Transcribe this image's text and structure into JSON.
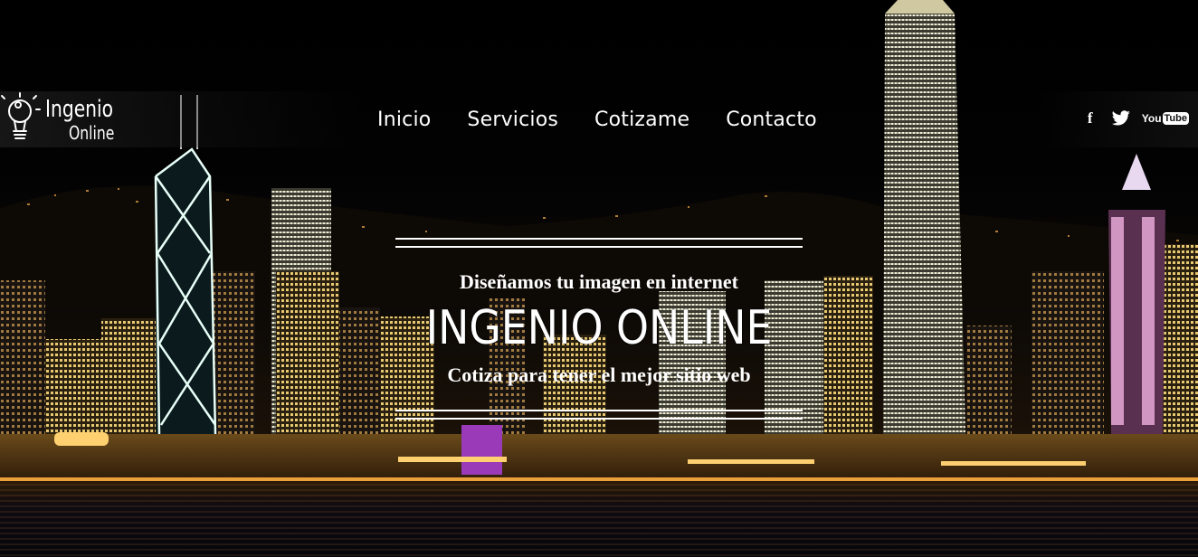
{
  "logo": {
    "line1": "Ingenio",
    "line2": "Online",
    "icon": "lightbulb-icon"
  },
  "nav": {
    "items": [
      "Inicio",
      "Servicios",
      "Cotizame",
      "Contacto"
    ]
  },
  "social": {
    "facebook_icon": "facebook-icon",
    "twitter_icon": "twitter-icon",
    "youtube_you": "You",
    "youtube_tube": "Tube"
  },
  "hero": {
    "tagline": "Diseñamos tu imagen en internet",
    "title": "INGENIO ONLINE",
    "subtitle": "Cotiza para tener el mejor sitio web"
  },
  "colors": {
    "text": "#ffffff",
    "background": "#000000"
  }
}
